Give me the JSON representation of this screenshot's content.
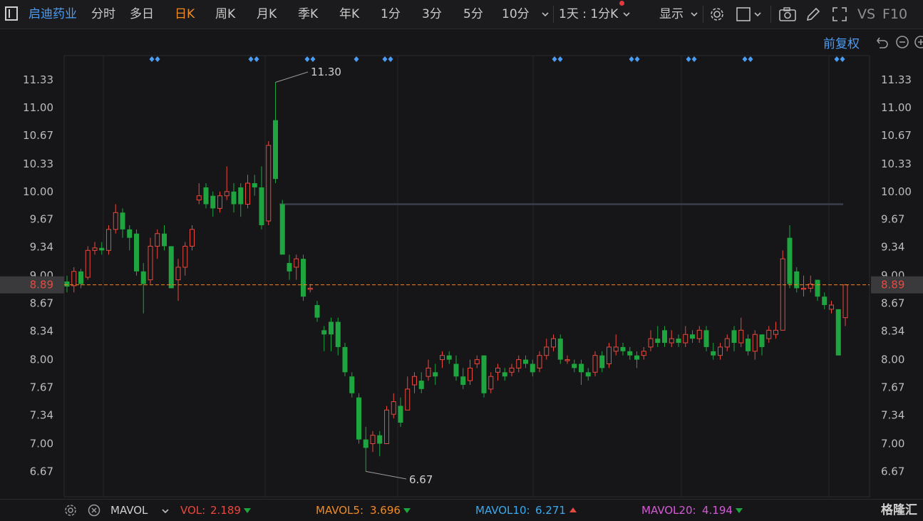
{
  "toolbar": {
    "stock_name": "启迪药业",
    "periods": [
      "分时",
      "多日",
      "日K",
      "周K",
      "月K",
      "季K",
      "年K",
      "1分",
      "3分",
      "5分",
      "10分"
    ],
    "active_period": "日K",
    "combo_label": "1天 : 1分K",
    "display_label": "显示",
    "vs_label": "VS",
    "f10_label": "F10"
  },
  "subbar": {
    "adjust_label": "前复权"
  },
  "colors": {
    "up": "#e8493f",
    "down": "#1fa53f",
    "line": "#3a3f4a",
    "price": "#e8493f",
    "accent": "#f08a24"
  },
  "chart_data": {
    "type": "candlestick",
    "y_ticks": [
      "11.33",
      "11.00",
      "10.67",
      "10.33",
      "10.00",
      "9.67",
      "9.34",
      "9.00",
      "8.67",
      "8.34",
      "8.00",
      "7.67",
      "7.34",
      "7.00",
      "6.67"
    ],
    "last_price": "8.89",
    "high_label": "11.30",
    "low_label": "6.67",
    "ylim": [
      6.5,
      11.5
    ],
    "reference_level": 9.85,
    "marker_counts": [
      2,
      2,
      2,
      1,
      2,
      2,
      2,
      2,
      2,
      2
    ],
    "candles": [
      [
        8.93,
        8.87,
        9.0,
        8.8
      ],
      [
        8.88,
        9.05,
        9.1,
        8.8
      ],
      [
        9.05,
        8.9,
        9.08,
        8.85
      ],
      [
        8.98,
        9.3,
        9.35,
        8.95
      ],
      [
        9.3,
        9.33,
        9.4,
        9.25
      ],
      [
        9.33,
        9.3,
        9.4,
        9.25
      ],
      [
        9.3,
        9.55,
        9.6,
        9.25
      ],
      [
        9.55,
        9.75,
        9.85,
        9.5
      ],
      [
        9.75,
        9.55,
        9.8,
        9.45
      ],
      [
        9.55,
        9.45,
        9.6,
        9.3
      ],
      [
        9.5,
        9.05,
        9.55,
        9.0
      ],
      [
        9.05,
        8.9,
        9.15,
        8.55
      ],
      [
        8.95,
        9.35,
        9.45,
        8.9
      ],
      [
        9.35,
        9.5,
        9.55,
        9.2
      ],
      [
        9.5,
        9.35,
        9.6,
        9.3
      ],
      [
        9.35,
        8.85,
        9.35,
        8.85
      ],
      [
        8.95,
        9.1,
        9.2,
        8.7
      ],
      [
        9.1,
        9.35,
        9.4,
        9.0
      ],
      [
        9.35,
        9.55,
        9.6,
        9.3
      ],
      [
        9.9,
        9.95,
        10.1,
        9.85
      ],
      [
        10.05,
        9.85,
        10.1,
        9.8
      ],
      [
        9.95,
        9.8,
        10.0,
        9.7
      ],
      [
        9.8,
        9.95,
        10.0,
        9.75
      ],
      [
        9.95,
        10.0,
        10.3,
        9.9
      ],
      [
        10.0,
        9.85,
        10.1,
        9.75
      ],
      [
        10.05,
        9.85,
        10.1,
        9.7
      ],
      [
        9.85,
        10.1,
        10.2,
        9.8
      ],
      [
        10.1,
        10.05,
        10.2,
        9.95
      ],
      [
        10.05,
        9.6,
        10.3,
        9.55
      ],
      [
        9.65,
        10.55,
        10.6,
        9.6
      ],
      [
        10.85,
        10.15,
        11.3,
        10.1
      ],
      [
        9.85,
        9.25,
        9.9,
        9.25
      ],
      [
        9.15,
        9.05,
        9.25,
        8.95
      ],
      [
        9.1,
        9.2,
        9.25,
        8.95
      ],
      [
        9.2,
        8.75,
        9.25,
        8.7
      ],
      [
        8.85,
        8.85,
        8.9,
        8.8
      ],
      [
        8.65,
        8.5,
        8.7,
        8.45
      ],
      [
        8.35,
        8.3,
        8.4,
        8.1
      ],
      [
        8.45,
        8.3,
        8.5,
        8.1
      ],
      [
        8.45,
        8.15,
        8.5,
        8.05
      ],
      [
        8.15,
        7.85,
        8.2,
        7.8
      ],
      [
        7.8,
        7.6,
        7.85,
        7.55
      ],
      [
        7.55,
        7.05,
        7.6,
        7.0
      ],
      [
        7.05,
        6.95,
        7.2,
        6.67
      ],
      [
        7.0,
        7.1,
        7.15,
        6.9
      ],
      [
        7.1,
        7.0,
        7.15,
        6.85
      ],
      [
        7.0,
        7.4,
        7.45,
        7.0
      ],
      [
        7.35,
        7.5,
        7.6,
        7.3
      ],
      [
        7.45,
        7.25,
        7.55,
        7.2
      ],
      [
        7.4,
        7.65,
        7.8,
        7.4
      ],
      [
        7.7,
        7.8,
        7.85,
        7.6
      ],
      [
        7.75,
        7.65,
        7.85,
        7.6
      ],
      [
        7.8,
        7.9,
        8.0,
        7.75
      ],
      [
        7.85,
        7.8,
        7.95,
        7.7
      ],
      [
        8.0,
        8.05,
        8.1,
        7.9
      ],
      [
        8.05,
        8.0,
        8.1,
        7.95
      ],
      [
        7.95,
        7.8,
        8.05,
        7.75
      ],
      [
        7.8,
        7.7,
        7.9,
        7.65
      ],
      [
        7.75,
        7.9,
        8.0,
        7.7
      ],
      [
        7.95,
        8.0,
        8.05,
        7.9
      ],
      [
        8.05,
        7.6,
        8.05,
        7.55
      ],
      [
        7.65,
        7.8,
        7.85,
        7.6
      ],
      [
        7.85,
        7.9,
        7.95,
        7.75
      ],
      [
        7.85,
        7.8,
        7.9,
        7.75
      ],
      [
        7.85,
        7.9,
        7.95,
        7.8
      ],
      [
        7.9,
        8.0,
        8.05,
        7.85
      ],
      [
        8.0,
        7.95,
        8.05,
        7.9
      ],
      [
        7.95,
        7.85,
        8.0,
        7.8
      ],
      [
        7.9,
        8.05,
        8.1,
        7.85
      ],
      [
        8.05,
        8.15,
        8.25,
        8.0
      ],
      [
        8.15,
        8.25,
        8.3,
        8.1
      ],
      [
        8.25,
        8.0,
        8.3,
        7.95
      ],
      [
        8.0,
        8.0,
        8.05,
        7.95
      ],
      [
        7.95,
        7.9,
        8.0,
        7.85
      ],
      [
        7.95,
        7.85,
        8.0,
        7.7
      ],
      [
        7.85,
        7.8,
        7.9,
        7.75
      ],
      [
        7.85,
        8.05,
        8.1,
        7.8
      ],
      [
        8.05,
        7.9,
        8.1,
        7.85
      ],
      [
        7.95,
        8.15,
        8.2,
        7.9
      ],
      [
        8.1,
        8.15,
        8.3,
        8.05
      ],
      [
        8.15,
        8.1,
        8.2,
        8.05
      ],
      [
        8.1,
        8.05,
        8.15,
        8.0
      ],
      [
        8.05,
        8.0,
        8.1,
        7.9
      ],
      [
        8.05,
        8.1,
        8.15,
        8.0
      ],
      [
        8.15,
        8.25,
        8.35,
        8.1
      ],
      [
        8.25,
        8.2,
        8.4,
        8.15
      ],
      [
        8.35,
        8.2,
        8.4,
        8.15
      ],
      [
        8.2,
        8.25,
        8.35,
        8.15
      ],
      [
        8.25,
        8.2,
        8.3,
        8.15
      ],
      [
        8.2,
        8.3,
        8.4,
        8.15
      ],
      [
        8.3,
        8.25,
        8.35,
        8.2
      ],
      [
        8.25,
        8.35,
        8.4,
        8.2
      ],
      [
        8.35,
        8.15,
        8.4,
        8.1
      ],
      [
        8.1,
        8.05,
        8.2,
        8.0
      ],
      [
        8.05,
        8.15,
        8.2,
        8.0
      ],
      [
        8.15,
        8.25,
        8.3,
        8.1
      ],
      [
        8.35,
        8.2,
        8.4,
        8.1
      ],
      [
        8.2,
        8.35,
        8.5,
        8.15
      ],
      [
        8.25,
        8.1,
        8.3,
        8.05
      ],
      [
        8.1,
        8.3,
        8.35,
        8.0
      ],
      [
        8.3,
        8.15,
        8.3,
        8.05
      ],
      [
        8.25,
        8.35,
        8.4,
        8.2
      ],
      [
        8.3,
        8.35,
        8.45,
        8.25
      ],
      [
        8.35,
        9.2,
        9.3,
        8.35
      ],
      [
        9.45,
        8.9,
        9.6,
        8.85
      ],
      [
        9.05,
        8.85,
        9.1,
        8.8
      ],
      [
        8.85,
        8.85,
        9.0,
        8.75
      ],
      [
        8.85,
        8.9,
        9.0,
        8.8
      ],
      [
        8.95,
        8.75,
        8.95,
        8.7
      ],
      [
        8.75,
        8.65,
        8.8,
        8.6
      ],
      [
        8.6,
        8.65,
        8.7,
        8.55
      ],
      [
        8.6,
        8.05,
        8.6,
        8.05
      ],
      [
        8.5,
        8.89,
        8.9,
        8.4
      ]
    ]
  },
  "volume_bar": {
    "indicator": "MAVOL",
    "vol_label": "VOL:",
    "vol_value": "2.189",
    "mavol5_label": "MAVOL5:",
    "mavol5_value": "3.696",
    "mavol10_label": "MAVOL10:",
    "mavol10_value": "6.271",
    "mavol20_label": "MAVOL20:",
    "mavol20_value": "4.194",
    "brand": "格隆汇"
  }
}
